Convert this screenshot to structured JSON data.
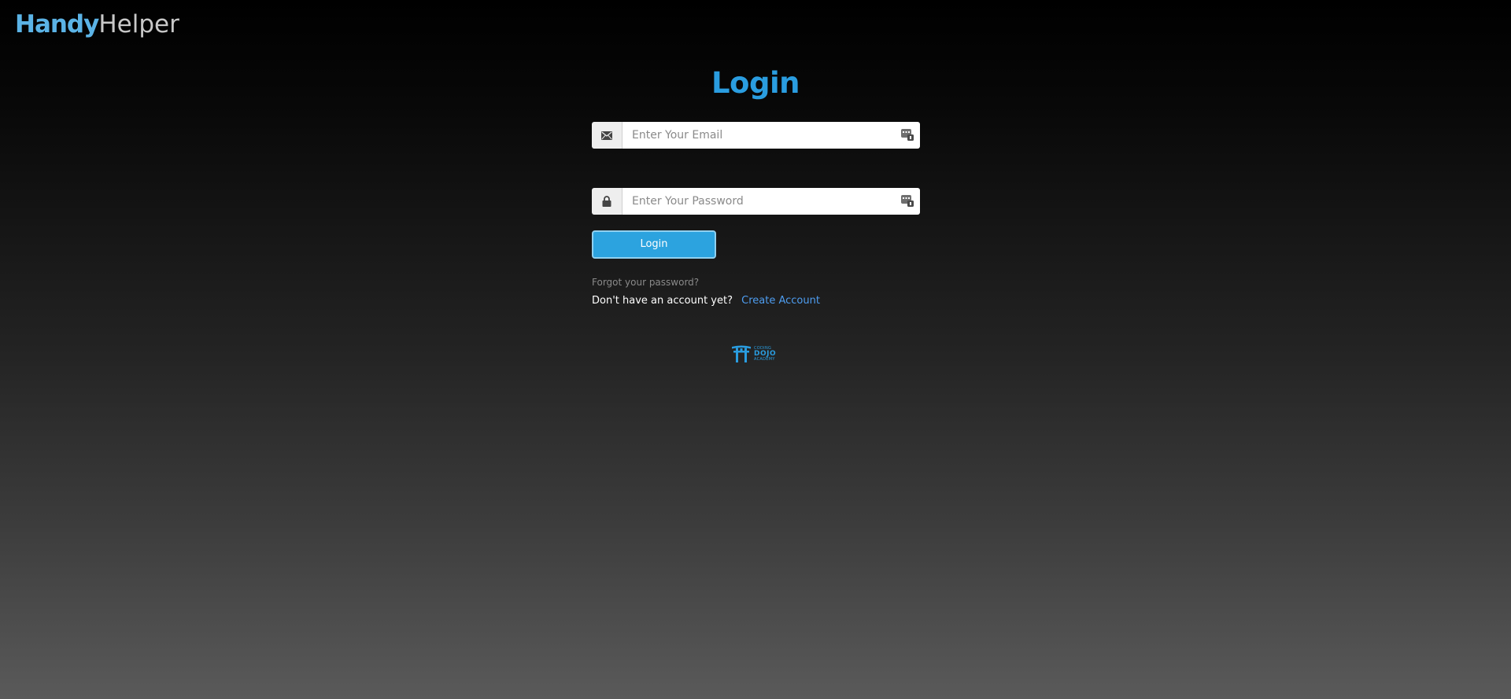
{
  "header": {
    "brand_bold": "Handy",
    "brand_light": "Helper"
  },
  "form": {
    "title": "Login",
    "email": {
      "placeholder": "Enter Your Email",
      "value": "",
      "icon": "envelope-icon"
    },
    "password": {
      "placeholder": "Enter Your Password",
      "value": "",
      "icon": "lock-icon"
    },
    "password_manager_icon": "password-manager-icon",
    "submit_label": "Login",
    "forgot_link": "Forgot your password?",
    "signup_prompt": "Don't have an account yet?",
    "signup_link": "Create Account"
  },
  "footer": {
    "logo_line1": "CODING",
    "logo_line2": "DOJO",
    "logo_line3": "ACADEMY"
  },
  "colors": {
    "accent": "#2a9de0",
    "brand_bold": "#5bb3e6",
    "link": "#4e9df0",
    "button": "#2ca3df"
  }
}
